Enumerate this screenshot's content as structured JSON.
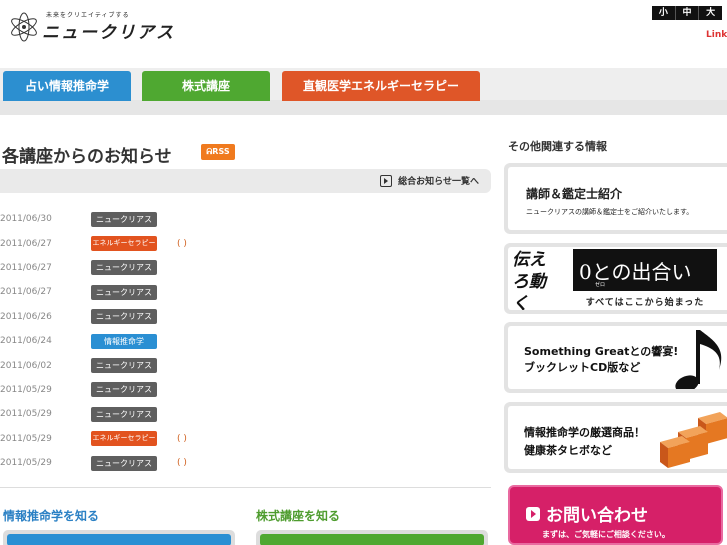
{
  "header": {
    "tagline": "未来をクリエイティブする",
    "logo_name": "ニュークリアス",
    "font_sizes": [
      "小",
      "中",
      "大"
    ],
    "link": "Link"
  },
  "tabs": [
    {
      "label": "占い情報推命学",
      "color": "#2c8fd0"
    },
    {
      "label": "株式講座",
      "color": "#4fa831"
    },
    {
      "label": "直観医学エネルギーセラピー",
      "color": "#df5628"
    }
  ],
  "news": {
    "title": "各講座からのお知らせ",
    "rss": "RSS",
    "all_link": "総合お知らせ一覧へ",
    "items": [
      {
        "date": "2011/06/30",
        "category": "ニュークリアス",
        "type": "gray",
        "extra": ""
      },
      {
        "date": "2011/06/27",
        "category": "エネルギーセラピー",
        "type": "orange",
        "extra": "( )"
      },
      {
        "date": "2011/06/27",
        "category": "ニュークリアス",
        "type": "gray",
        "extra": ""
      },
      {
        "date": "2011/06/27",
        "category": "ニュークリアス",
        "type": "gray",
        "extra": ""
      },
      {
        "date": "2011/06/26",
        "category": "ニュークリアス",
        "type": "gray",
        "extra": ""
      },
      {
        "date": "2011/06/24",
        "category": "情報推命学",
        "type": "blue",
        "extra": ""
      },
      {
        "date": "2011/06/02",
        "category": "ニュークリアス",
        "type": "gray",
        "extra": ""
      },
      {
        "date": "2011/05/29",
        "category": "ニュークリアス",
        "type": "gray",
        "extra": ""
      },
      {
        "date": "2011/05/29",
        "category": "ニュークリアス",
        "type": "gray",
        "extra": ""
      },
      {
        "date": "2011/05/29",
        "category": "エネルギーセラピー",
        "type": "orange",
        "extra": "( )"
      },
      {
        "date": "2011/05/29",
        "category": "ニュークリアス",
        "type": "gray",
        "extra": "( )"
      }
    ]
  },
  "know": {
    "left": "情報推命学を知る",
    "right": "株式講座を知る"
  },
  "sidebar": {
    "title": "その他関連する情報",
    "card1": {
      "title": "講師＆鑑定士紹介",
      "sub": "ニュークリアスの講師＆鑑定士をご紹介いたします。"
    },
    "card2": {
      "hand": "伝えろ動く",
      "book_title": "0との出合い",
      "book_ruby": "ゼロ",
      "sub": "すべてはここから始まった"
    },
    "card3": {
      "line1": "Something Greatとの響宴!",
      "line2": "ブックレットCD版など"
    },
    "card4": {
      "line1": "情報推命学の厳選商品！",
      "line2": "健康茶タヒボなど"
    },
    "contact": {
      "title": "お問い合わせ",
      "sub": "まずは、ご気軽にご相談ください。"
    }
  }
}
